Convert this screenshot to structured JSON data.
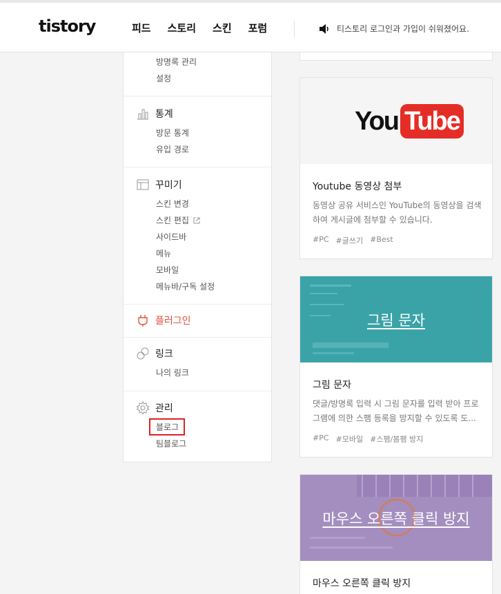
{
  "header": {
    "logo": "tistory",
    "nav": [
      "피드",
      "스토리",
      "스킨",
      "포럼"
    ],
    "notice": "티스토리 로그인과 가입이 쉬워졌어요."
  },
  "sidebar": {
    "top_items": [
      "방명록 관리",
      "설정"
    ],
    "stats": {
      "title": "통계",
      "items": [
        "방문 통계",
        "유입 경로"
      ]
    },
    "decorate": {
      "title": "꾸미기",
      "items": [
        "스킨 변경",
        "스킨 편집",
        "사이드바",
        "메뉴",
        "모바일",
        "메뉴바/구독 설정"
      ]
    },
    "plugin": {
      "title": "플러그인"
    },
    "link": {
      "title": "링크",
      "items": [
        "나의 링크"
      ]
    },
    "manage": {
      "title": "관리",
      "items": [
        "블로그",
        "팀블로그"
      ]
    }
  },
  "cards": [
    {
      "thumb_you": "You",
      "thumb_tube": "Tube",
      "title": "Youtube 동영상 첨부",
      "desc": "동영상 공유 서비스인 YouTube의 동영상을 검색하여 게시글에 첨부할 수 있습니다.",
      "tags": [
        "#PC",
        "#글쓰기",
        "#Best"
      ]
    },
    {
      "thumb_text": "그림 문자",
      "title": "그림 문자",
      "desc": "댓글/방명록 입력 시 그림 문자를 입력 받아 프로그램에 의한 스팸 등록을 방지할 수 있도록 도...",
      "tags": [
        "#PC",
        "#모바일",
        "#스팸/봄팸 방지"
      ]
    },
    {
      "thumb_text": "마우스 오른쪽 클릭 방지",
      "title": "마우스 오른쪽 클릭 방지"
    }
  ],
  "colors": {
    "plugin": "#e0513b",
    "teal": "#3aa3a8",
    "purple": "#a48ec0",
    "highlight": "#e02020"
  }
}
